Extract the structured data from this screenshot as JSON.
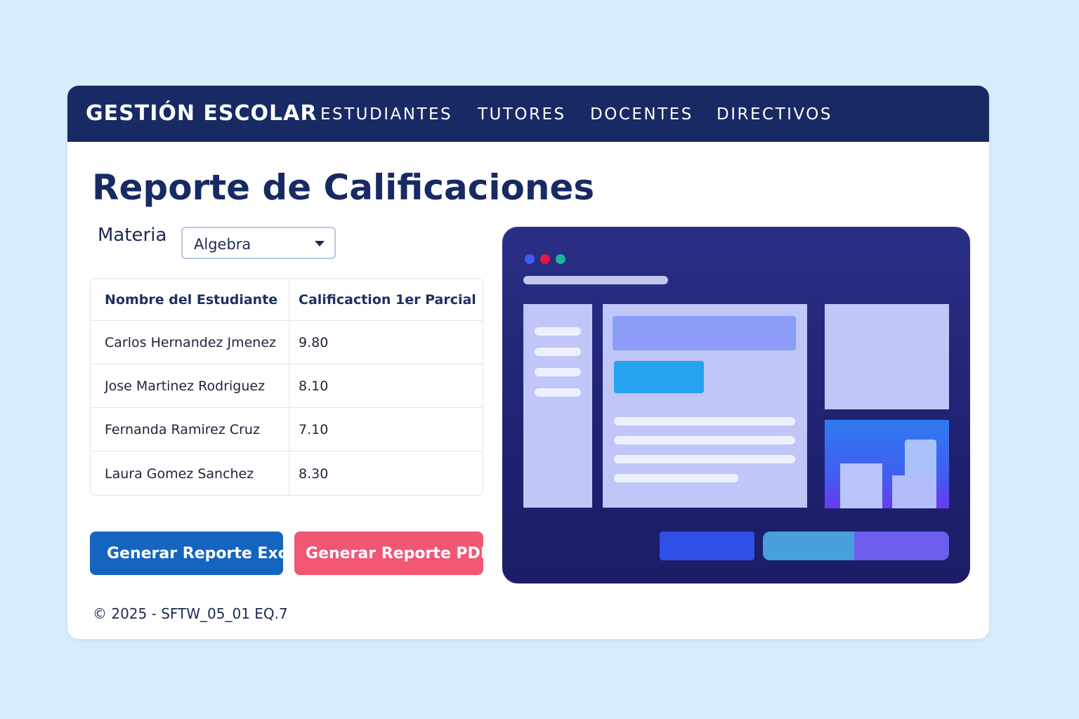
{
  "nav": {
    "brand": "GESTIÓN ESCOLAR",
    "links": [
      "ESTUDIANTES",
      "TUTORES",
      "DOCENTES",
      "DIRECTIVOS"
    ]
  },
  "page": {
    "title": "Reporte de Calificaciones",
    "subject_label": "Materia",
    "subject_selected": "Algebra"
  },
  "table": {
    "headers": [
      "Nombre del Estudiante",
      "Calificaction 1er Parcial"
    ],
    "rows": [
      [
        "Carlos Hernandez Jmenez",
        "9.80"
      ],
      [
        "Jose Martinez Rodriguez",
        "8.10"
      ],
      [
        "Fernanda Ramirez Cruz",
        "7.10"
      ],
      [
        "Laura Gomez Sanchez",
        "8.30"
      ]
    ]
  },
  "buttons": {
    "excel": "Generar Reporte  Excel",
    "pdf": "Generar Reporte PDF"
  },
  "footer": "© 2025 - SFTW_05_01 EQ.7",
  "colors": {
    "navbar": "#182a64",
    "excel_button": "#1565c0",
    "pdf_button": "#f15673",
    "page_background": "#d8edfc"
  }
}
